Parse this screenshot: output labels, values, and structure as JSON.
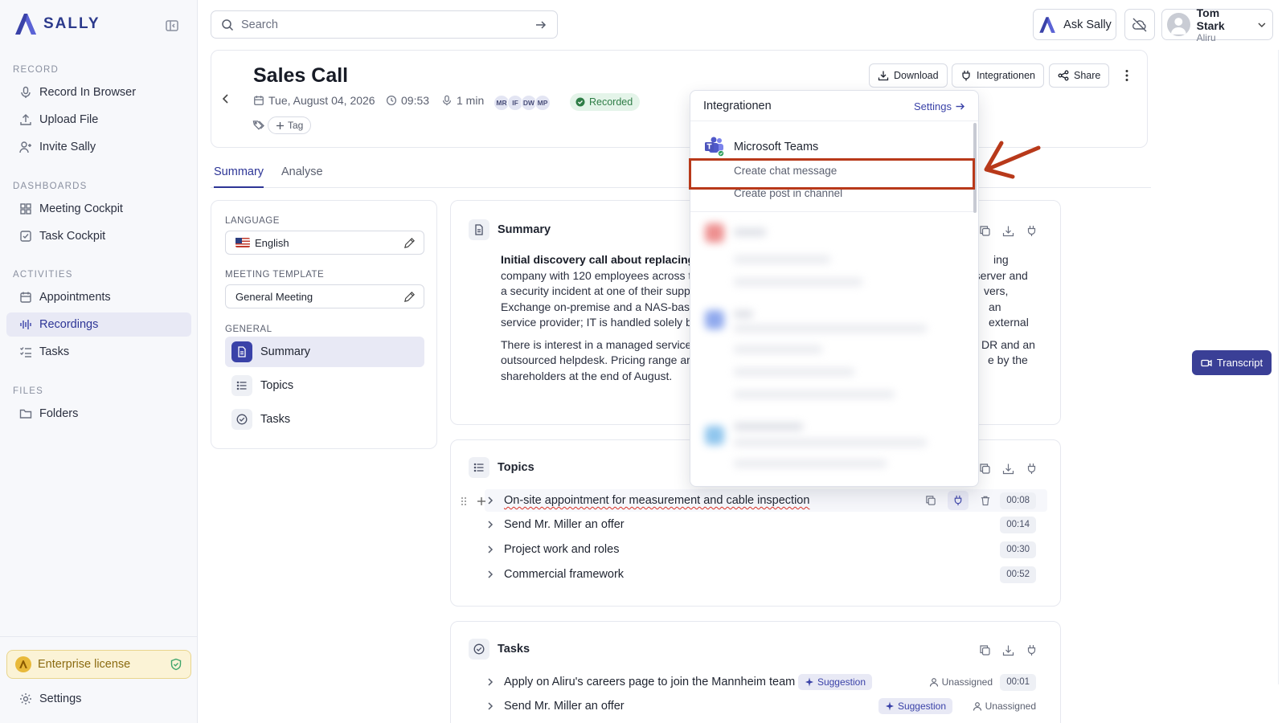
{
  "app": {
    "brand": "SALLY",
    "accent": "#3a42a8"
  },
  "sidebar": {
    "sections": [
      {
        "title": "RECORD",
        "items": [
          {
            "label": "Record In Browser",
            "icon": "microphone-icon"
          },
          {
            "label": "Upload File",
            "icon": "upload-icon"
          },
          {
            "label": "Invite Sally",
            "icon": "user-plus-icon"
          }
        ]
      },
      {
        "title": "DASHBOARDS",
        "items": [
          {
            "label": "Meeting Cockpit",
            "icon": "grid-icon"
          },
          {
            "label": "Task Cockpit",
            "icon": "checkbox-icon"
          }
        ]
      },
      {
        "title": "ACTIVITIES",
        "items": [
          {
            "label": "Appointments",
            "icon": "calendar-icon"
          },
          {
            "label": "Recordings",
            "icon": "waveform-icon",
            "active": true
          },
          {
            "label": "Tasks",
            "icon": "list-check-icon"
          }
        ]
      },
      {
        "title": "FILES",
        "items": [
          {
            "label": "Folders",
            "icon": "folder-icon"
          }
        ]
      }
    ],
    "license": "Enterprise license",
    "settings": "Settings"
  },
  "topbar": {
    "search_placeholder": "Search",
    "ask": "Ask Sally",
    "user": {
      "name": "Tom Stark",
      "org": "Aliru"
    }
  },
  "meeting": {
    "title": "Sales Call",
    "date": "Tue, August 04, 2026",
    "time": "09:53",
    "duration": "1 min",
    "participants": [
      "MR",
      "IF",
      "DW",
      "MP"
    ],
    "status": "Recorded",
    "tag_button": "Tag",
    "actions": {
      "download": "Download",
      "integrations": "Integrationen",
      "share": "Share"
    }
  },
  "tabs": [
    {
      "label": "Summary",
      "active": true
    },
    {
      "label": "Analyse"
    }
  ],
  "left_panel": {
    "language_label": "LANGUAGE",
    "language": "English",
    "template_label": "MEETING TEMPLATE",
    "template": "General Meeting",
    "general_label": "GENERAL",
    "items": [
      "Summary",
      "Topics",
      "Tasks"
    ]
  },
  "summary": {
    "title": "Summary",
    "p1_bold": "Initial discovery call about replacing t",
    "p1_lines": [
      "company with 120 employees across t",
      "a security incident at one of their supp",
      "Exchange on-premise and a NAS-base",
      "service provider; IT is handled solely by"
    ],
    "p1_right": [
      "ing",
      "e server and",
      "vers,",
      "an external"
    ],
    "p2_lines": [
      "There is interest in a managed service",
      "outsourced helpdesk. Pricing range ar",
      "shareholders at the end of August."
    ],
    "p2_right": [
      "DR and an",
      "e by the"
    ]
  },
  "topics": {
    "title": "Topics",
    "rows": [
      {
        "label": "On-site appointment for measurement and cable inspection",
        "time": "00:08"
      },
      {
        "label": "Send Mr. Miller an offer",
        "time": "00:14"
      },
      {
        "label": "Project work and roles",
        "time": "00:30"
      },
      {
        "label": "Commercial framework",
        "time": "00:52"
      }
    ]
  },
  "tasks": {
    "title": "Tasks",
    "rows": [
      {
        "label": "Apply on Aliru's careers page to join the Mannheim team",
        "badge": "Suggestion",
        "assignee": "Unassigned",
        "time": "00:01"
      },
      {
        "label": "Send Mr. Miller an offer",
        "badge": "Suggestion",
        "assignee": "Unassigned"
      }
    ]
  },
  "transcript_button": "Transcript",
  "integrations_dropdown": {
    "title": "Integrationen",
    "settings": "Settings",
    "provider": "Microsoft Teams",
    "options": [
      "Create chat message",
      "Create post in channel"
    ],
    "highlight_color": "#b8391a"
  }
}
